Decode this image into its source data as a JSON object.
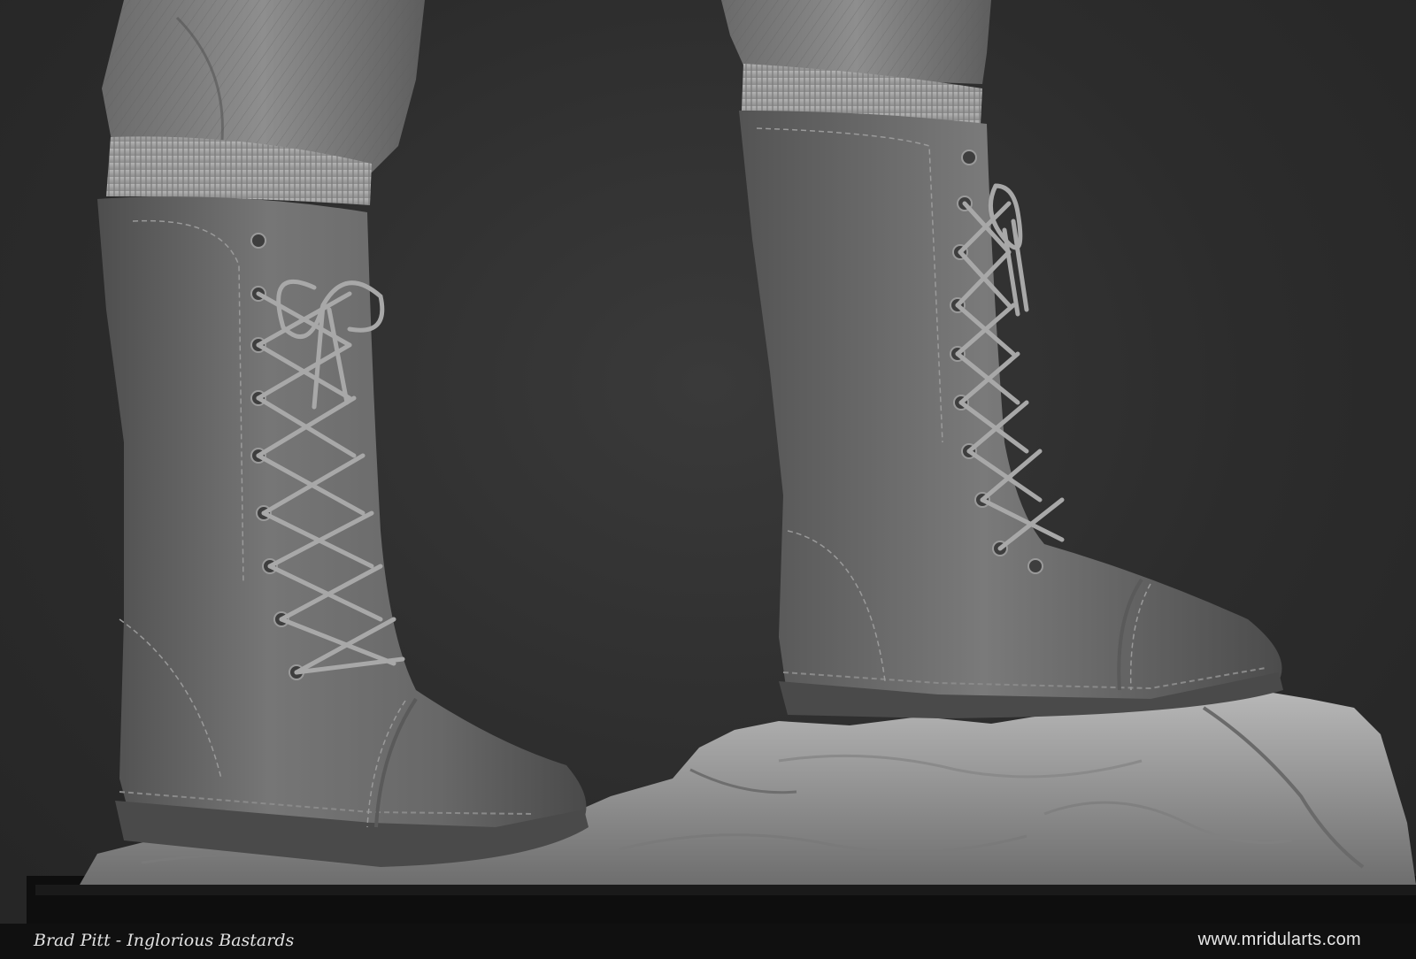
{
  "caption": {
    "title": "Brad Pitt - Inglorious Bastards",
    "website": "www.mridularts.com"
  },
  "image": {
    "subject": "sculpt-render-lace-up-boots-on-rocks",
    "colors": {
      "background": "#2c2c2c",
      "clay": "#6e6e6e",
      "rock": "#9a9a9a",
      "caption_bar": "#101010",
      "caption_text": "#e2e2e2"
    }
  }
}
